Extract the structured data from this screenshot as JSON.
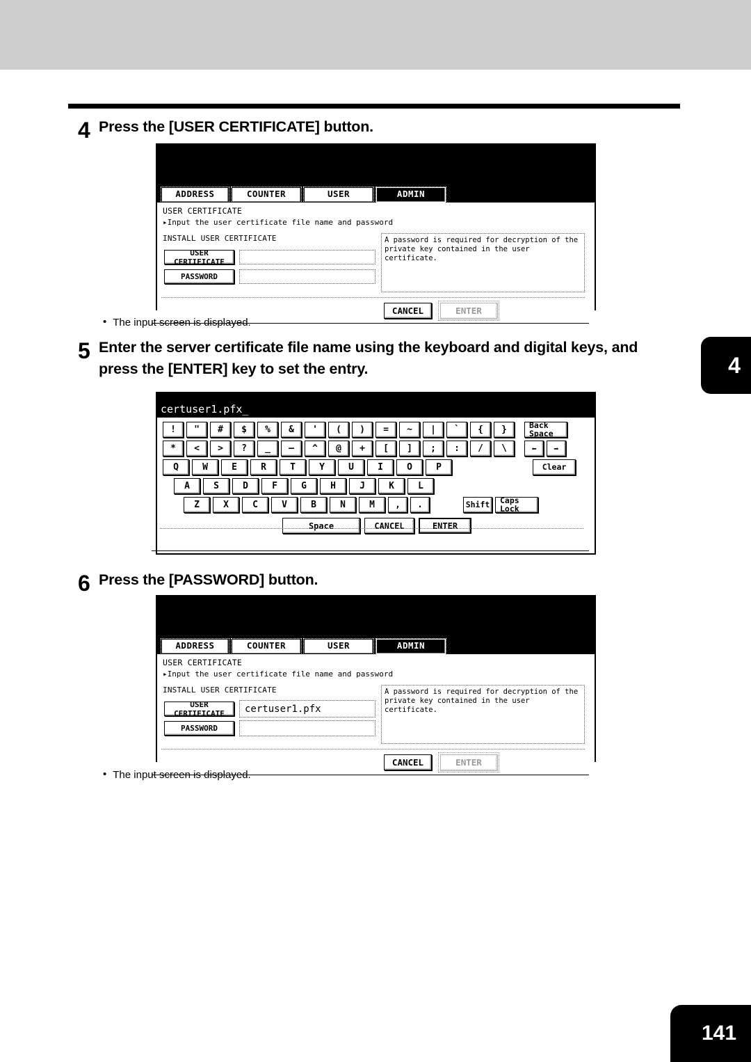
{
  "page": {
    "number": "141",
    "side_tab": "4"
  },
  "steps": [
    {
      "num": "4",
      "text": "Press the [USER CERTIFICATE] button.",
      "caption_bullet": "•",
      "caption": "The input screen is displayed."
    },
    {
      "num": "5",
      "text": "Enter the server certificate file name using the keyboard and digital keys, and press the [ENTER] key to set the entry."
    },
    {
      "num": "6",
      "text": "Press the [PASSWORD] button.",
      "caption_bullet": "•",
      "caption": "The input screen is displayed."
    }
  ],
  "panel_cert": {
    "tabs": [
      {
        "label": "ADDRESS",
        "selected": false
      },
      {
        "label": "COUNTER",
        "selected": false
      },
      {
        "label": "USER",
        "selected": false
      },
      {
        "label": "ADMIN",
        "selected": true
      }
    ],
    "title": "USER CERTIFICATE",
    "prompt": "▸Input the user certificate file name and password",
    "section": "INSTALL USER CERTIFICATE",
    "user_certificate_button": "USER CERTIFICATE",
    "user_certificate_value": "",
    "password_button": "PASSWORD",
    "password_value": "",
    "help_text": "A password is required for decryption of the private key contained in the user certificate.",
    "cancel_button": "CANCEL",
    "enter_button": "ENTER",
    "enter_enabled": false
  },
  "panel_cert_filled": {
    "tabs": [
      {
        "label": "ADDRESS",
        "selected": false
      },
      {
        "label": "COUNTER",
        "selected": false
      },
      {
        "label": "USER",
        "selected": false
      },
      {
        "label": "ADMIN",
        "selected": true
      }
    ],
    "title": "USER CERTIFICATE",
    "prompt": "▸Input the user certificate file name and password",
    "section": "INSTALL USER CERTIFICATE",
    "user_certificate_button": "USER CERTIFICATE",
    "user_certificate_value": "certuser1.pfx",
    "password_button": "PASSWORD",
    "password_value": "",
    "help_text": "A password is required for decryption of the private key contained in the user certificate.",
    "cancel_button": "CANCEL",
    "enter_button": "ENTER",
    "enter_enabled": false
  },
  "keyboard": {
    "display_value": "certuser1.pfx_",
    "row1": [
      "!",
      "\"",
      "#",
      "$",
      "%",
      "&",
      "'",
      "(",
      ")",
      "=",
      "~",
      "|",
      "`",
      "{",
      "}"
    ],
    "row1_special": "Back Space",
    "row2": [
      "*",
      "<",
      ">",
      "?",
      "_",
      "—",
      "^",
      "@",
      "+",
      "[",
      "]",
      ";",
      ":",
      "/",
      "\\"
    ],
    "row2_special": [
      "⬅",
      "➡"
    ],
    "row3": [
      "Q",
      "W",
      "E",
      "R",
      "T",
      "Y",
      "U",
      "I",
      "O",
      "P"
    ],
    "row3_special": "Clear",
    "row4": [
      "A",
      "S",
      "D",
      "F",
      "G",
      "H",
      "J",
      "K",
      "L"
    ],
    "row5": [
      "Z",
      "X",
      "C",
      "V",
      "B",
      "N",
      "M",
      ",",
      "."
    ],
    "row5_special": [
      "Shift",
      "Caps Lock"
    ],
    "bottom": [
      "Space",
      "CANCEL",
      "ENTER"
    ]
  }
}
